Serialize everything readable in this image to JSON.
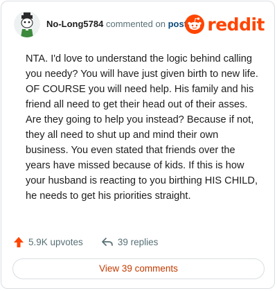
{
  "comment": {
    "username": "No-Long5784",
    "action_text": "commented on",
    "post_link_text": "post",
    "body": "NTA. I'd love to understand the logic behind calling you needy? You will have just given birth to new life. OF COURSE you will need help. His family and his friend all need to get their head out of their asses. Are they going to help you instead? Because if not, they all need to shut up and mind their own business. You even stated that friends over the years have missed because of kids. If this is how your husband is reacting to you birthing HIS CHILD, he needs to get his priorities straight.",
    "upvotes": "5.9K upvotes",
    "replies": "39 replies",
    "view_button": "View 39 comments"
  },
  "brand": {
    "wordmark": "reddit",
    "color": "#ff4500"
  },
  "icons": {
    "avatar": "user-avatar",
    "logo": "reddit-snoo-icon",
    "upvote": "upvote-arrow-icon",
    "reply": "reply-arrow-icon"
  },
  "colors": {
    "upvote": "#ff4500",
    "link": "#0a4a7a",
    "button_text": "#c23a00"
  }
}
